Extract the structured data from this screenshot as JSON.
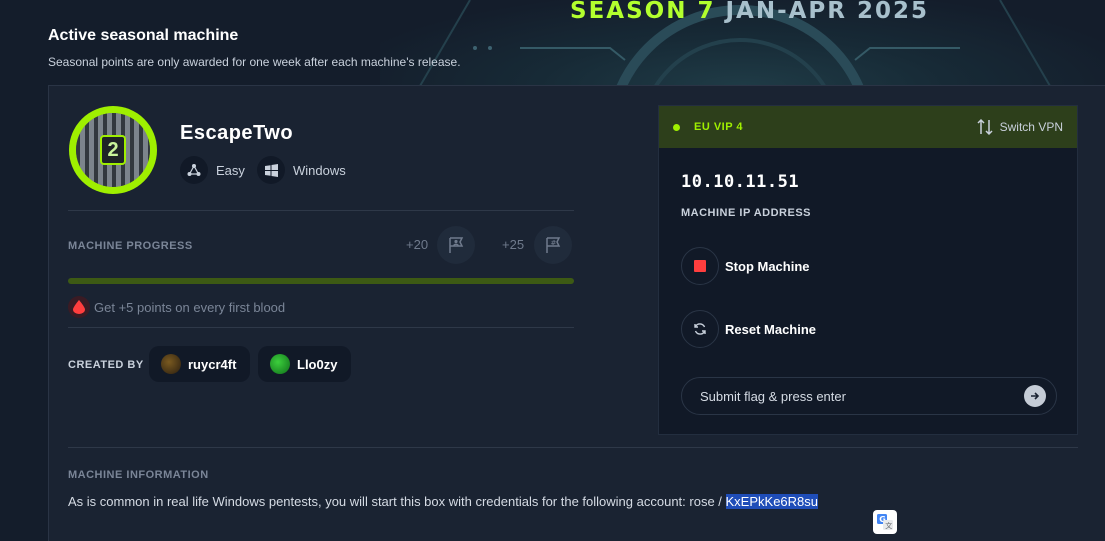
{
  "banner": {
    "season_word": "SEASON 7",
    "season_dates": " JAN-APR 2025"
  },
  "section": {
    "title": "Active seasonal machine",
    "subtitle": "Seasonal points are only awarded for one week after each machine's release."
  },
  "machine": {
    "avatar_digit": "2",
    "name": "EscapeTwo",
    "difficulty": "Easy",
    "os": "Windows",
    "progress_label": "MACHINE PROGRESS",
    "user_points": "+20",
    "root_points": "+25",
    "progress_fraction": 1.0,
    "blood_text": "Get +5 points on every first blood",
    "created_by_label": "CREATED BY",
    "authors": [
      {
        "name": "ruycr4ft"
      },
      {
        "name": "Llo0zy"
      }
    ],
    "info_label": "MACHINE INFORMATION",
    "info_text": "As is common in real life Windows pentests, you will start this box with credentials for the following account: rose / ",
    "credential_password": "KxEPkKe6R8su"
  },
  "vpn": {
    "server": "EU VIP 4",
    "switch_label": "Switch VPN",
    "ip": "10.10.11.51",
    "ip_label": "MACHINE IP ADDRESS",
    "stop_label": "Stop Machine",
    "reset_label": "Reset Machine",
    "flag_placeholder": "Submit flag & press enter"
  },
  "colors": {
    "accent": "#9fef00",
    "background": "#141d2b",
    "card": "#1a2332",
    "stop_red": "#ff3e3e",
    "selection": "#1f4db8"
  }
}
